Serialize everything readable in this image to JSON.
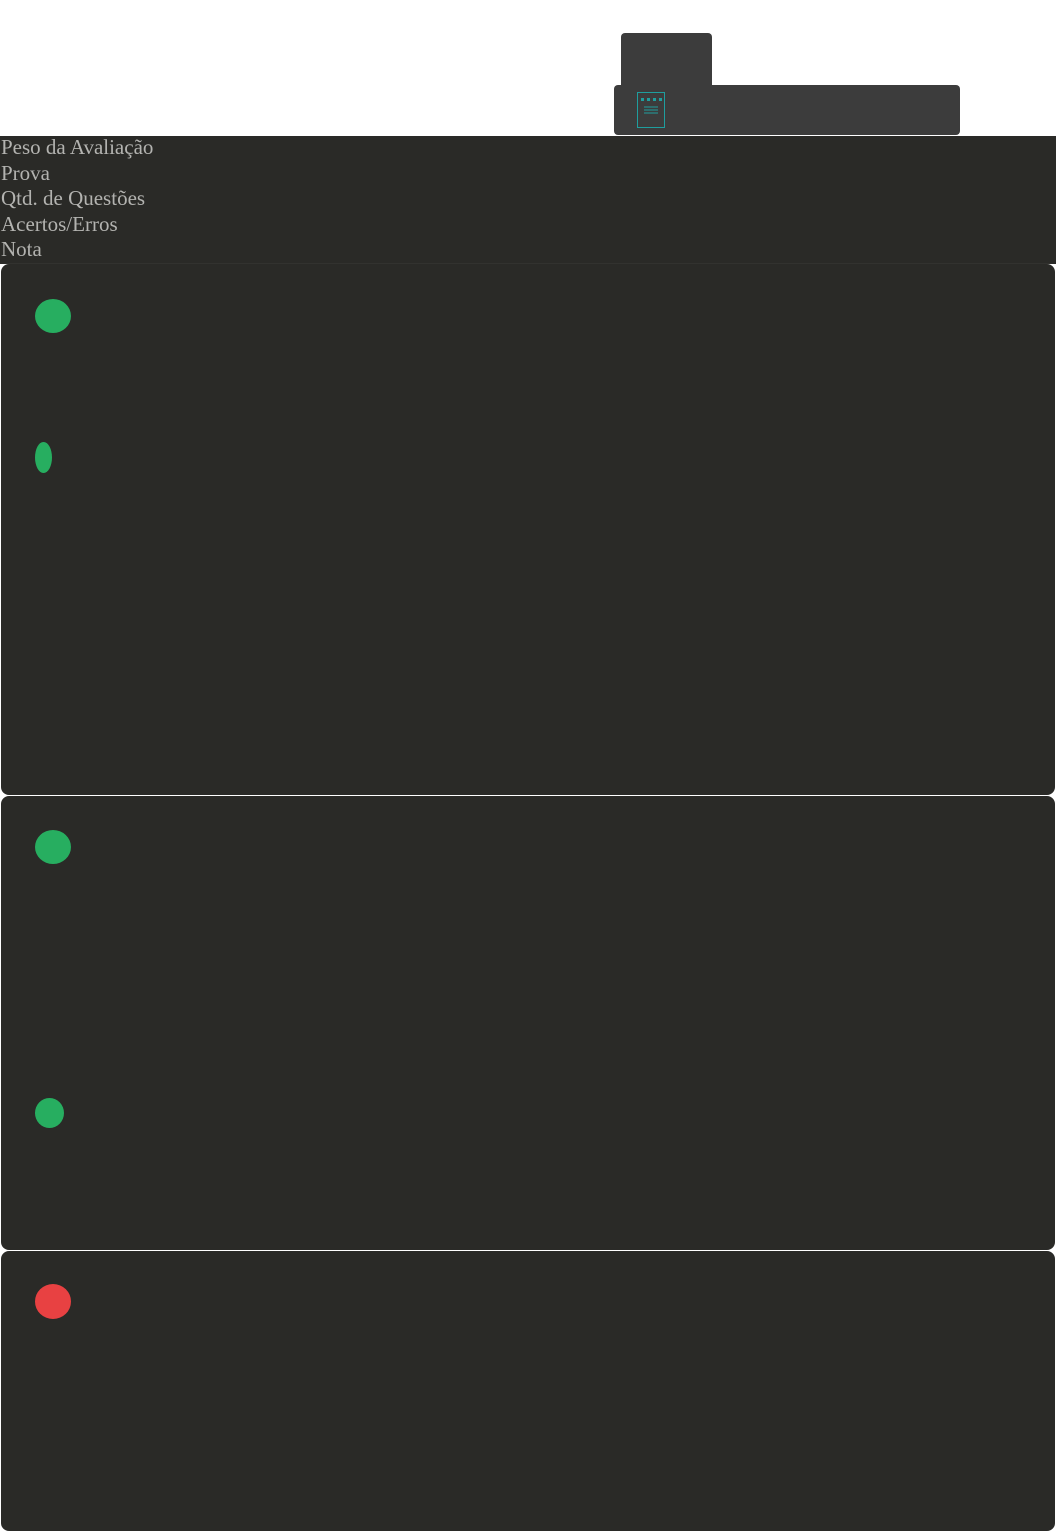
{
  "header": {
    "labels": [
      "Peso da Avaliação",
      "Prova",
      "Qtd. de Questões",
      "Acertos/Erros",
      "Nota"
    ]
  },
  "colors": {
    "page_bg": "#ffffff",
    "card_bg": "#2a2a27",
    "tab_bg": "#3c3c3c",
    "label_text": "#b3b3b0",
    "success": "#27ae60",
    "error": "#e84142",
    "icon_accent": "#1f9e9e"
  },
  "cards": [
    {
      "indicator": "success",
      "secondary_indicator": "success"
    },
    {
      "indicator": "success",
      "secondary_indicator": "success"
    },
    {
      "indicator": "error"
    }
  ],
  "icons": {
    "document": "document-icon"
  }
}
